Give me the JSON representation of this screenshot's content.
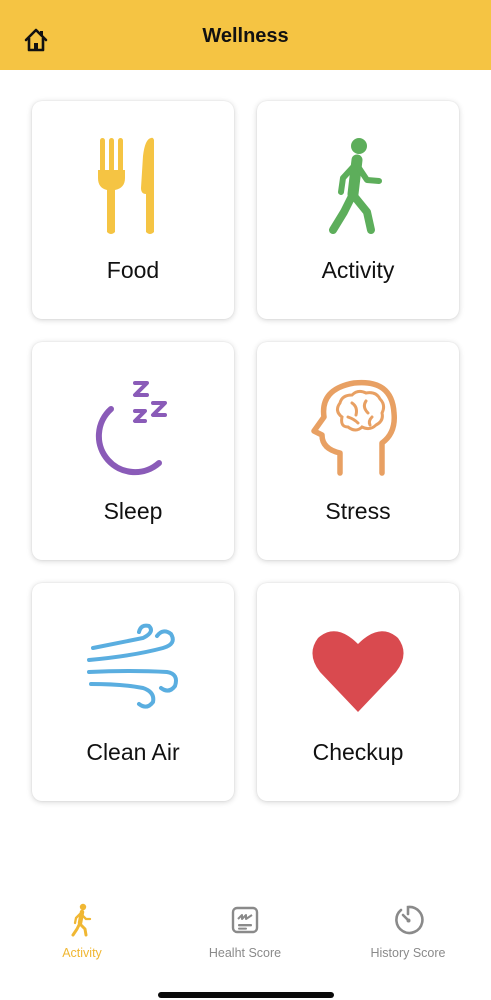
{
  "header": {
    "title": "Wellness",
    "home_icon": "home-icon",
    "background": "#F5C443"
  },
  "tiles": [
    {
      "label": "Food",
      "icon": "fork-knife-icon",
      "color": "#F5C443"
    },
    {
      "label": "Activity",
      "icon": "walking-person-icon",
      "color": "#5DAE5B"
    },
    {
      "label": "Sleep",
      "icon": "moon-zzz-icon",
      "color": "#8A5BB8"
    },
    {
      "label": "Stress",
      "icon": "head-brain-icon",
      "color": "#E8A063"
    },
    {
      "label": "Clean Air",
      "icon": "wind-icon",
      "color": "#5AAEE0"
    },
    {
      "label": "Checkup",
      "icon": "heart-icon",
      "color": "#D94A4F"
    }
  ],
  "tabbar": {
    "tabs": [
      {
        "label": "Activity",
        "icon": "walking-person-icon",
        "active": true
      },
      {
        "label": "Healht Score",
        "icon": "score-card-icon",
        "active": false
      },
      {
        "label": "History Score",
        "icon": "timer-icon",
        "active": false
      }
    ],
    "active_color": "#F0B733",
    "inactive_color": "#8A8A8A"
  }
}
